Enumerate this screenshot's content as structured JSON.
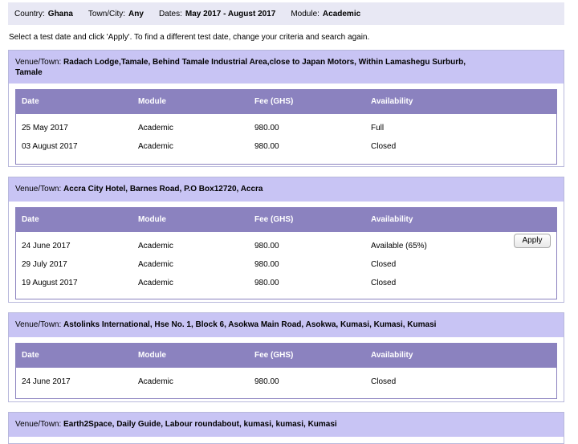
{
  "criteria": [
    {
      "label": "Country:",
      "value": "Ghana"
    },
    {
      "label": "Town/City:",
      "value": "Any"
    },
    {
      "label": "Dates:",
      "value": "May 2017 - August 2017"
    },
    {
      "label": "Module:",
      "value": "Academic"
    }
  ],
  "instructions": "Select a test date and click 'Apply'. To find a different test date, change your criteria and search again.",
  "venue_label": "Venue/Town:",
  "columns": {
    "date": "Date",
    "module": "Module",
    "fee": "Fee (GHS)",
    "availability": "Availability"
  },
  "apply_label": "Apply",
  "venues": [
    {
      "name_line1": "Radach Lodge,Tamale, Behind Tamale Industrial Area,close to Japan Motors, Within Lamashegu Surburb,",
      "name_line2": "Tamale",
      "rows": [
        {
          "date": "25 May 2017",
          "module": "Academic",
          "fee": "980.00",
          "availability": "Full"
        },
        {
          "date": "03 August 2017",
          "module": "Academic",
          "fee": "980.00",
          "availability": "Closed"
        }
      ]
    },
    {
      "name": "Accra City Hotel, Barnes Road, P.O Box12720, Accra",
      "rows": [
        {
          "date": "24 June 2017",
          "module": "Academic",
          "fee": "980.00",
          "availability": "Available (65%)"
        },
        {
          "date": "29 July 2017",
          "module": "Academic",
          "fee": "980.00",
          "availability": "Closed"
        },
        {
          "date": "19 August 2017",
          "module": "Academic",
          "fee": "980.00",
          "availability": "Closed"
        }
      ]
    },
    {
      "name": "Astolinks International, Hse No. 1, Block 6, Asokwa Main Road, Asokwa, Kumasi, Kumasi, Kumasi",
      "rows": [
        {
          "date": "24 June 2017",
          "module": "Academic",
          "fee": "980.00",
          "availability": "Closed"
        }
      ]
    },
    {
      "name": "Earth2Space, Daily Guide, Labour roundabout, kumasi, kumasi, Kumasi",
      "rows": []
    }
  ]
}
